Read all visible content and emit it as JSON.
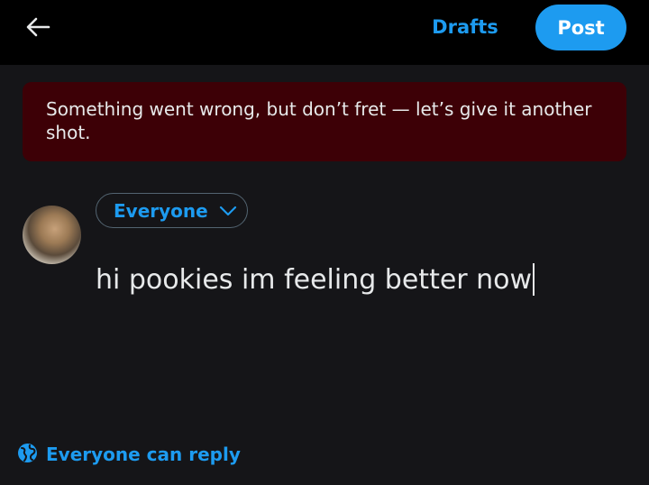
{
  "header": {
    "drafts_label": "Drafts",
    "post_label": "Post"
  },
  "error_banner": {
    "message": "Something went wrong, but don’t fret — let’s give it another shot."
  },
  "composer": {
    "audience_label": "Everyone",
    "text": "hi pookies im feeling better now"
  },
  "footer": {
    "reply_setting_label": "Everyone can reply"
  },
  "colors": {
    "accent": "#1d9bf0",
    "error_background": "#3d0006",
    "header_background": "#000000",
    "page_background": "#151518"
  },
  "icons": {
    "back": "arrow-left-icon",
    "audience_dropdown": "chevron-down-icon",
    "reply_setting": "globe-icon"
  }
}
